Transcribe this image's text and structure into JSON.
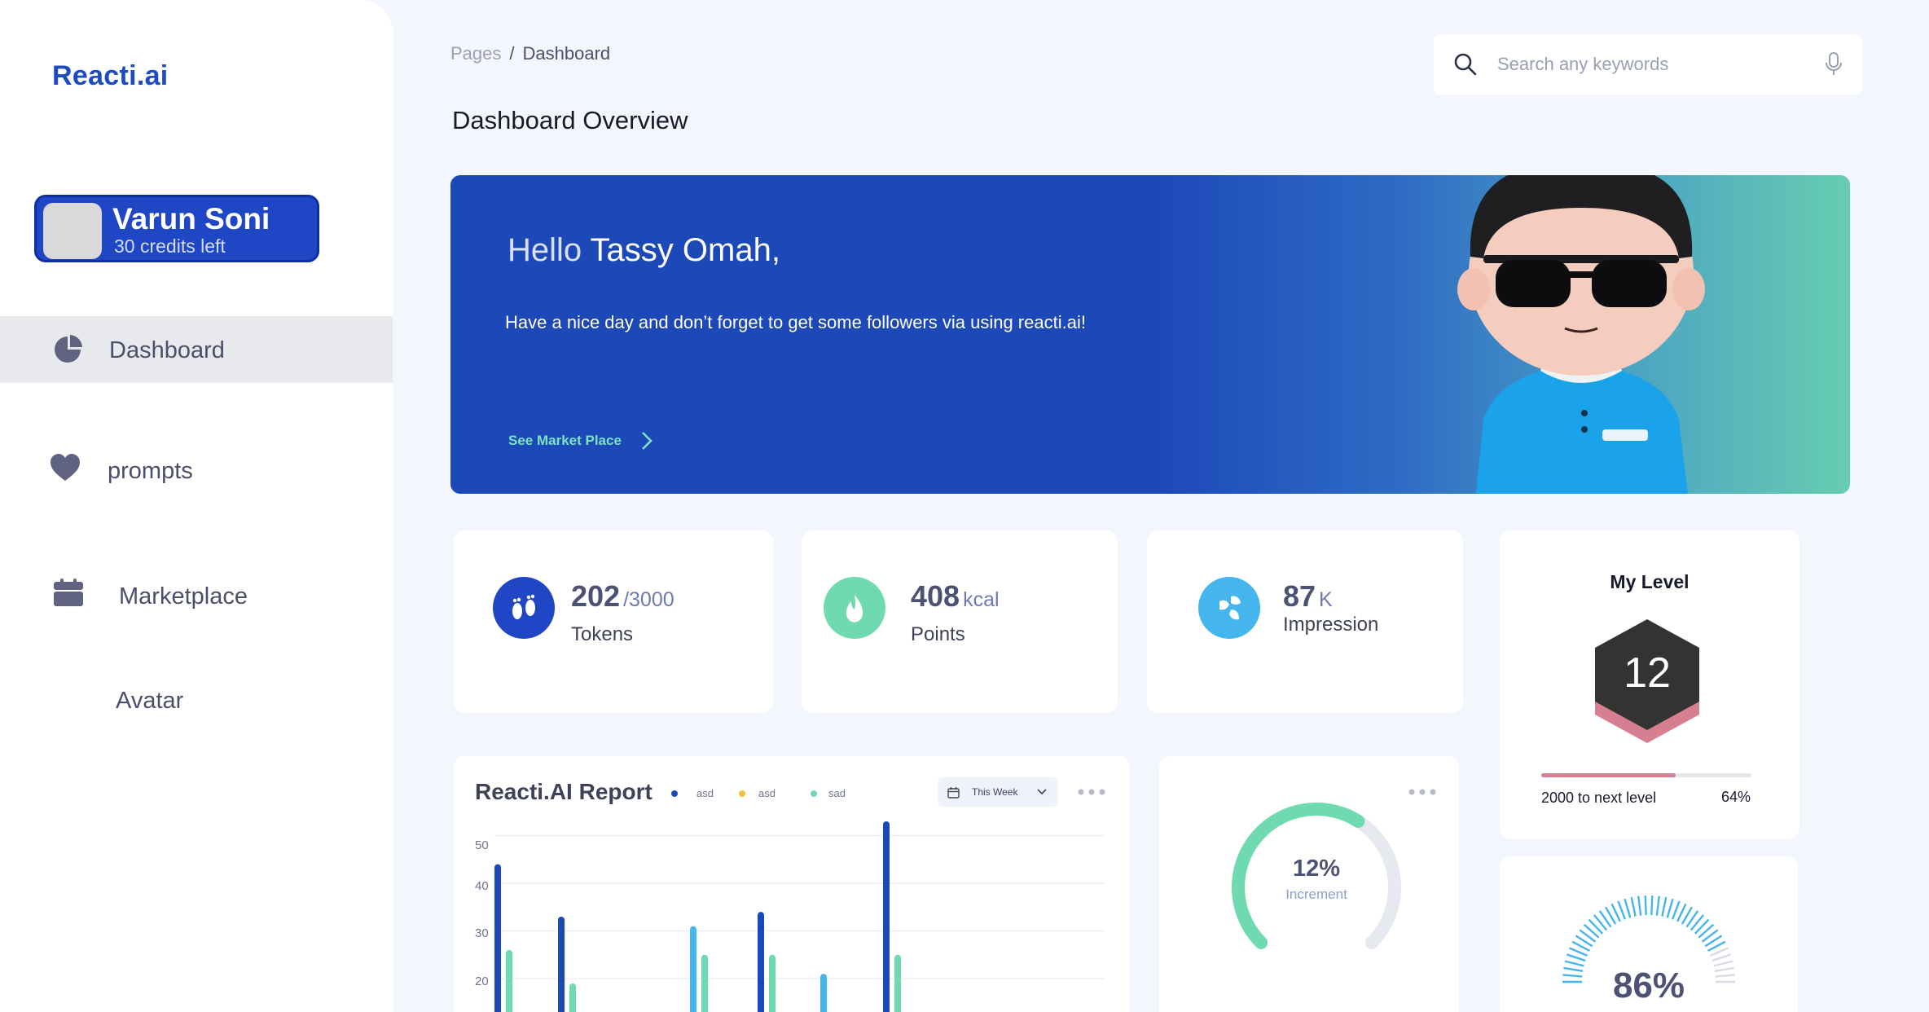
{
  "app": {
    "logo": "Reacti.ai"
  },
  "user": {
    "name": "Varun Soni",
    "credits": "30 credits left"
  },
  "sidebar": {
    "items": [
      {
        "label": "Dashboard",
        "icon": "pie-chart-icon",
        "active": true
      },
      {
        "label": "prompts",
        "icon": "heart-icon"
      },
      {
        "label": "Marketplace",
        "icon": "calendar-icon"
      },
      {
        "label": "Avatar"
      }
    ]
  },
  "header": {
    "breadcrumb_root": "Pages",
    "breadcrumb_sep": "/",
    "breadcrumb_current": "Dashboard",
    "title": "Dashboard Overview",
    "search_placeholder": "Search any keywords"
  },
  "hero": {
    "greeting": "Hello",
    "name": "Tassy Omah,",
    "message": "Have a nice day and don’t forget to get some followers via using reacti.ai!",
    "link": "See Market Place"
  },
  "stats": [
    {
      "value": "202",
      "unit": "/3000",
      "label": "Tokens",
      "icon": "footprints-icon",
      "color": "#1f46c4"
    },
    {
      "value": "408",
      "unit": "kcal",
      "label": "Points",
      "icon": "flame-icon",
      "color": "#6fd9b0"
    },
    {
      "value": "87",
      "unit": "K",
      "label": "Impression",
      "icon": "drops-icon",
      "color": "#45b5ee"
    }
  ],
  "level": {
    "title": "My Level",
    "value": "12",
    "progress_text": "2000 to next level",
    "percent_label": "64%",
    "percent": 0.64
  },
  "report": {
    "title": "Reacti.AI Report",
    "range_label": "This Week",
    "legend": [
      {
        "name": "asd",
        "color": "#1c48b8"
      },
      {
        "name": "asd",
        "color": "#f2c12e"
      },
      {
        "name": "sad",
        "color": "#6fd9b0"
      }
    ]
  },
  "increment": {
    "value": "12%",
    "label": "Increment",
    "fraction": 0.62
  },
  "gauge2": {
    "value": "86%",
    "fraction": 0.86
  },
  "chart_data": {
    "type": "bar",
    "title": "Reacti.AI Report",
    "xlabel": "",
    "ylabel": "",
    "ylim": [
      0,
      55
    ],
    "y_ticks": [
      20,
      30,
      40,
      50
    ],
    "grid": true,
    "legend_position": "top",
    "series": [
      {
        "name": "asd",
        "color": "#1c48b8",
        "values": [
          44,
          33,
          4,
          8,
          34,
          0,
          53
        ]
      },
      {
        "name": "sad",
        "color": "#6fd9b0",
        "values": [
          26,
          19,
          0,
          25,
          25,
          0,
          25
        ]
      },
      {
        "name": "",
        "color": "#45b5ee",
        "values": [
          3,
          0,
          0,
          31,
          0,
          21,
          0
        ]
      }
    ]
  },
  "colors": {
    "accent": "#1f46c4",
    "teal": "#6fd9b0",
    "pink": "#d67f90",
    "background": "#f3f7fd"
  }
}
